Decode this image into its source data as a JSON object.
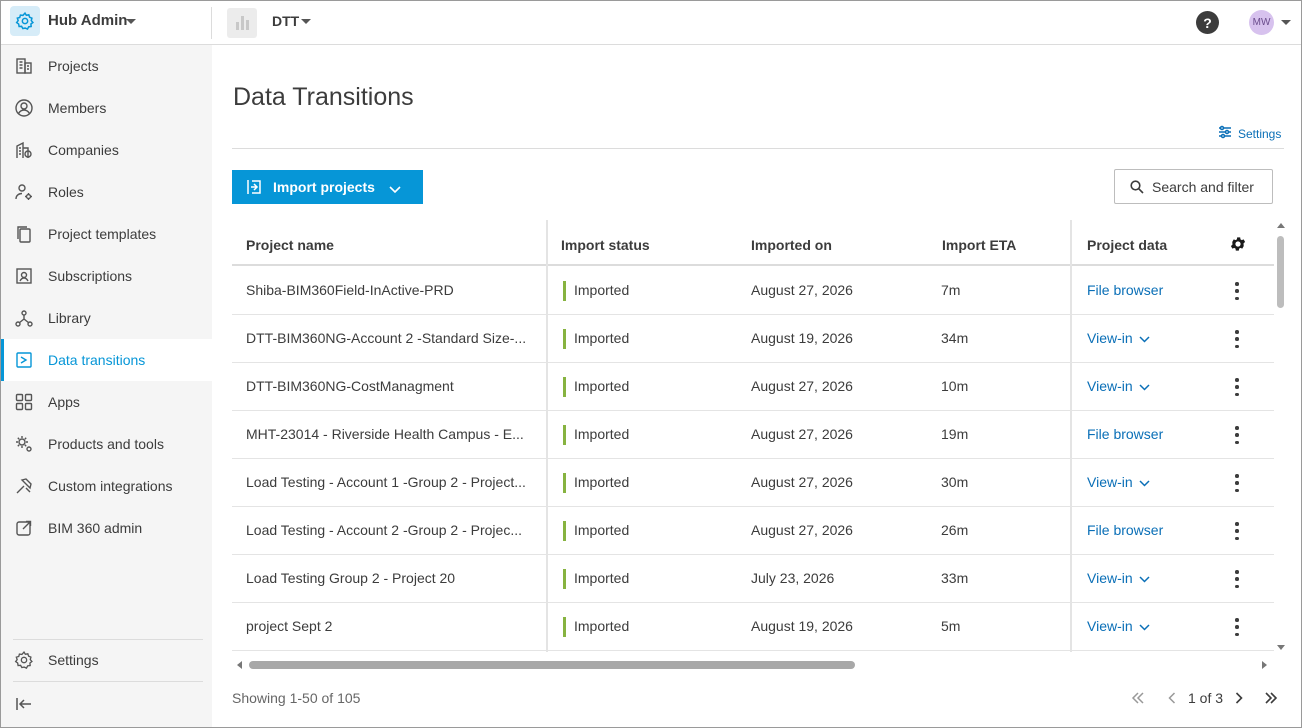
{
  "topbar": {
    "hub_title": "Hub Admin",
    "project_name": "DTT",
    "help_label": "?",
    "avatar_initials": "MW"
  },
  "sidebar": {
    "items": [
      {
        "label": "Projects",
        "icon": "building-icon"
      },
      {
        "label": "Members",
        "icon": "user-circle-icon"
      },
      {
        "label": "Companies",
        "icon": "company-icon"
      },
      {
        "label": "Roles",
        "icon": "user-gear-icon"
      },
      {
        "label": "Project templates",
        "icon": "template-icon"
      },
      {
        "label": "Subscriptions",
        "icon": "subscription-icon"
      },
      {
        "label": "Library",
        "icon": "library-icon"
      },
      {
        "label": "Data transitions",
        "icon": "data-transition-icon",
        "active": true
      },
      {
        "label": "Apps",
        "icon": "apps-grid-icon"
      },
      {
        "label": "Products and tools",
        "icon": "gears-icon"
      },
      {
        "label": "Custom integrations",
        "icon": "integrations-icon"
      },
      {
        "label": "BIM 360 admin",
        "icon": "external-link-icon"
      }
    ],
    "settings_label": "Settings",
    "collapse_icon": "collapse-icon"
  },
  "main": {
    "title": "Data Transitions",
    "settings_link": "Settings",
    "import_button": "Import projects",
    "search_button": "Search and filter"
  },
  "table": {
    "headers": [
      "Project name",
      "Import status",
      "Imported on",
      "Import ETA",
      "Project data"
    ],
    "rows": [
      {
        "name": "Shiba-BIM360Field-InActive-PRD",
        "status": "Imported",
        "date": "August 27, 2026",
        "eta": "7m",
        "data": "File browser",
        "dropdown": false
      },
      {
        "name": "DTT-BIM360NG-Account 2 -Standard Size-...",
        "status": "Imported",
        "date": "August 19, 2026",
        "eta": "34m",
        "data": "View-in",
        "dropdown": true
      },
      {
        "name": "DTT-BIM360NG-CostManagment",
        "status": "Imported",
        "date": "August 27, 2026",
        "eta": "10m",
        "data": "View-in",
        "dropdown": true
      },
      {
        "name": "MHT-23014 - Riverside Health Campus - E...",
        "status": "Imported",
        "date": "August 27, 2026",
        "eta": "19m",
        "data": "File browser",
        "dropdown": false
      },
      {
        "name": "Load Testing - Account 1 -Group 2 - Project...",
        "status": "Imported",
        "date": "August 27, 2026",
        "eta": "30m",
        "data": "View-in",
        "dropdown": true
      },
      {
        "name": "Load Testing - Account 2 -Group 2 - Projec...",
        "status": "Imported",
        "date": "August 27, 2026",
        "eta": "26m",
        "data": "File browser",
        "dropdown": false
      },
      {
        "name": "Load Testing Group 2 - Project 20",
        "status": "Imported",
        "date": "July 23, 2026",
        "eta": "33m",
        "data": "View-in",
        "dropdown": true
      },
      {
        "name": "project Sept 2",
        "status": "Imported",
        "date": "August 19, 2026",
        "eta": "5m",
        "data": "View-in",
        "dropdown": true
      }
    ]
  },
  "footer": {
    "showing": "Showing 1-50 of 105",
    "page_text": "1 of 3"
  },
  "colors": {
    "accent": "#0696d7",
    "link": "#0a6fb7",
    "status_imported": "#87b340"
  }
}
